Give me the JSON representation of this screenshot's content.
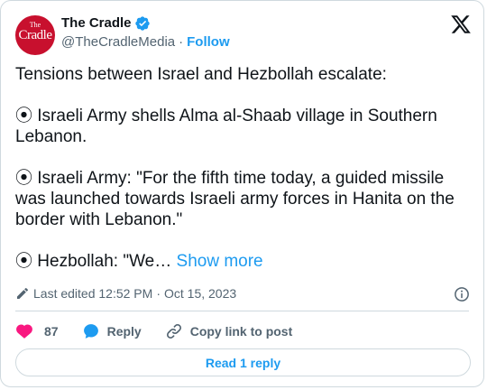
{
  "author": {
    "name": "The Cradle",
    "handle": "@TheCradleMedia",
    "separator": "·",
    "follow_label": "Follow",
    "avatar_text_small": "The",
    "avatar_text_large": "Cradle"
  },
  "tweet": {
    "lines": [
      "Tensions between Israel and Hezbollah escalate:",
      "⦿ Israeli Army shells Alma al-Shaab village in Southern Lebanon.",
      "⦿ Israeli Army: \"For the fifth time today, a guided missile was launched towards Israeli army forces in Hanita on the border with Lebanon.\"",
      "⦿ Hezbollah: \"We…"
    ],
    "show_more": "Show more"
  },
  "meta": {
    "edited_label": "Last edited 12:52 PM",
    "separator": "·",
    "date": "Oct 15, 2023"
  },
  "actions": {
    "like_count": "87",
    "reply_label": "Reply",
    "copy_label": "Copy link to post"
  },
  "footer": {
    "read_reply_label": "Read 1 reply"
  },
  "colors": {
    "accent": "#1d9bf0",
    "like": "#f91880",
    "avatar_bg": "#c8102e",
    "muted": "#536471"
  },
  "icons": [
    "verified-badge-icon",
    "x-logo-icon",
    "edit-pencil-icon",
    "info-icon",
    "heart-icon",
    "reply-bubble-icon",
    "link-icon"
  ]
}
